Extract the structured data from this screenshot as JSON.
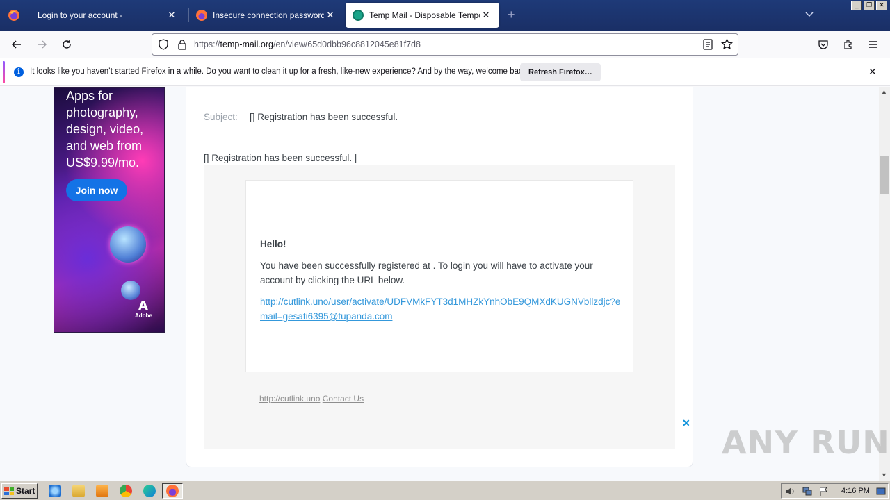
{
  "browser": {
    "tabs": [
      {
        "title": "Login to your account -",
        "active": false
      },
      {
        "title": "Insecure connection password warn",
        "active": false
      },
      {
        "title": "Temp Mail - Disposable Temporary E",
        "active": true
      }
    ],
    "url_prefix": "https://",
    "url_host": "temp-mail.org",
    "url_path": "/en/view/65d0dbb96c8812045e81f7d8",
    "notification": {
      "message": "It looks like you haven’t started Firefox in a while. Do you want to clean it up for a fresh, like-new experience? And by the way, welcome back!",
      "button": "Refresh Firefox…"
    }
  },
  "ad": {
    "text": "Apps for photography, design, video, and web from US$9.99/mo.",
    "cta": "Join now",
    "brand": "Adobe",
    "brand_glyph": "A"
  },
  "email": {
    "subject_label": "Subject:",
    "subject": "[] Registration has been successful.",
    "body_heading": "[] Registration has been successful. |",
    "greeting": "Hello!",
    "paragraph": "You have been successfully registered at . To login you will have to activate your account by clicking the URL below.",
    "link": "http://cutlink.uno/user/activate/UDFVMkFYT3d1MHZkYnhObE9QMXdKUGNVbllzdjc?email=gesati6395@tupanda.com",
    "footer_site": "http://cutlink.uno",
    "footer_contact": "Contact Us"
  },
  "watermark": "ANY RUN",
  "taskbar": {
    "start": "Start",
    "clock": "4:16 PM"
  }
}
